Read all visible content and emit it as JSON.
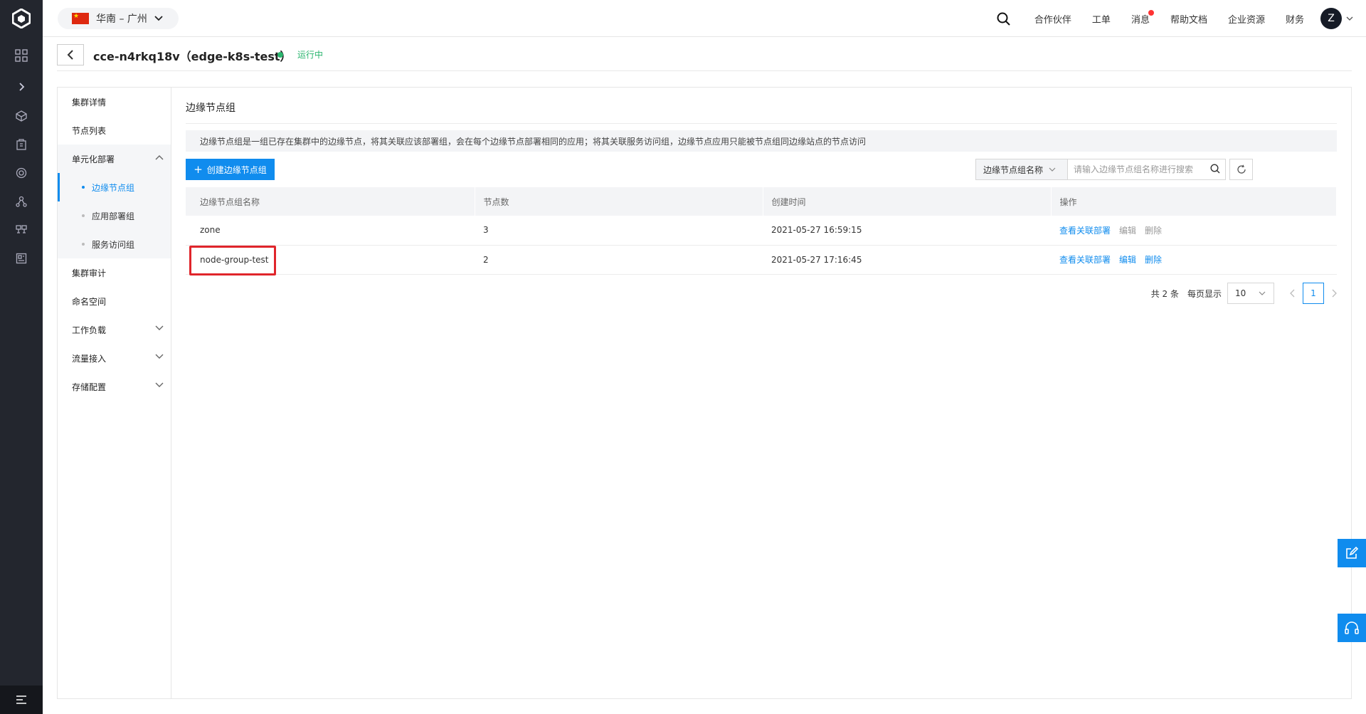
{
  "region": {
    "label": "华南 – 广州"
  },
  "topnav": {
    "partners": "合作伙伴",
    "tickets": "工单",
    "messages": "消息",
    "docs": "帮助文档",
    "enterprise": "企业资源",
    "finance": "财务",
    "avatar_letter": "Z"
  },
  "cluster": {
    "title": "cce-n4rkq18v（edge-k8s-test）",
    "status": "运行中"
  },
  "sidenav": {
    "cluster_detail": "集群详情",
    "node_list": "节点列表",
    "unit_deploy": "单元化部署",
    "edge_node_group": "边缘节点组",
    "app_deploy_group": "应用部署组",
    "service_access_group": "服务访问组",
    "cluster_audit": "集群审计",
    "namespace": "命名空间",
    "workload": "工作负载",
    "traffic_ingress": "流量接入",
    "storage_config": "存储配置"
  },
  "main": {
    "title": "边缘节点组",
    "info": "边缘节点组是一组已存在集群中的边缘节点，将其关联应该部署组，会在每个边缘节点部署相同的应用；将其关联服务访问组，边缘节点应用只能被节点组同边缘站点的节点访问",
    "create_button": "创建边缘节点组",
    "search_field": "边缘节点组名称",
    "search_placeholder": "请输入边缘节点组名称进行搜索"
  },
  "table": {
    "headers": [
      "边缘节点组名称",
      "节点数",
      "创建时间",
      "操作"
    ],
    "rows": [
      {
        "name": "zone",
        "nodes": "3",
        "created": "2021-05-27 16:59:15",
        "op_view": "查看关联部署",
        "op_edit": "编辑",
        "op_delete": "删除"
      },
      {
        "name": "node-group-test",
        "nodes": "2",
        "created": "2021-05-27 17:16:45",
        "op_view": "查看关联部署",
        "op_edit": "编辑",
        "op_delete": "删除"
      }
    ]
  },
  "pager": {
    "total": "共 2 条",
    "per_page_label": "每页显示",
    "per_page": "10",
    "current": "1"
  },
  "colors": {
    "accent": "#108cee",
    "running": "#2ab56e",
    "highlight": "#e0252b",
    "rail": "#23262e"
  }
}
